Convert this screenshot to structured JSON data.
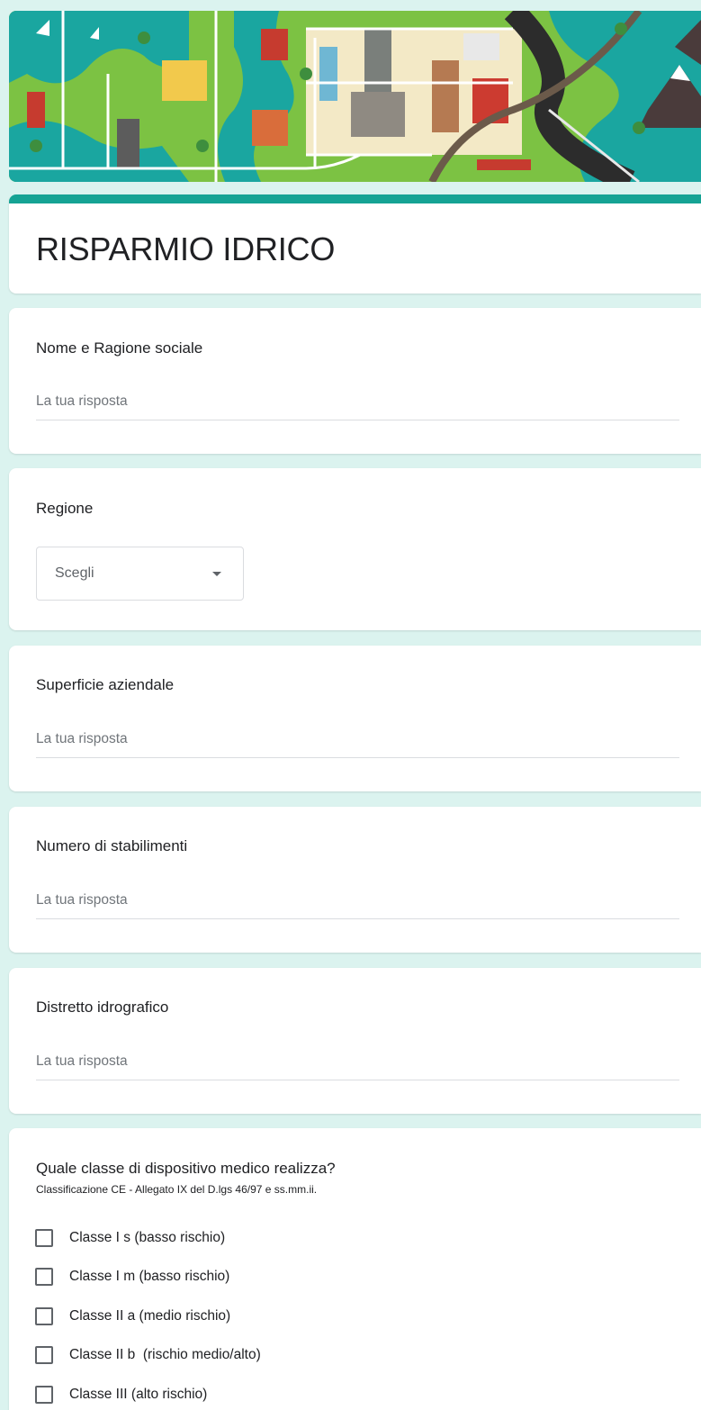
{
  "form": {
    "title": "RISPARMIO IDRICO",
    "header_image": "city-map-illustration",
    "accent_color": "#15a394",
    "background_color": "#dbf3ef"
  },
  "questions": [
    {
      "title": "Nome e Ragione sociale",
      "placeholder": "La tua risposta"
    },
    {
      "title": "Regione",
      "select_value": "Scegli",
      "icon": "dropdown-arrow-icon"
    },
    {
      "title": "Superficie aziendale",
      "placeholder": "La tua risposta"
    },
    {
      "title": "Numero di stabilimenti",
      "placeholder": "La tua risposta"
    },
    {
      "title": "Distretto idrografico",
      "placeholder": "La tua risposta"
    },
    {
      "title": "Quale classe di dispositivo medico realizza?",
      "description": "Classificazione CE - Allegato IX del D.lgs 46/97 e ss.mm.ii.",
      "options": [
        "Classe I s (basso rischio)",
        "Classe I m (basso rischio)",
        "Classe II a (medio rischio)",
        "Classe II b  (rischio medio/alto)",
        "Classe III (alto rischio)"
      ]
    }
  ]
}
